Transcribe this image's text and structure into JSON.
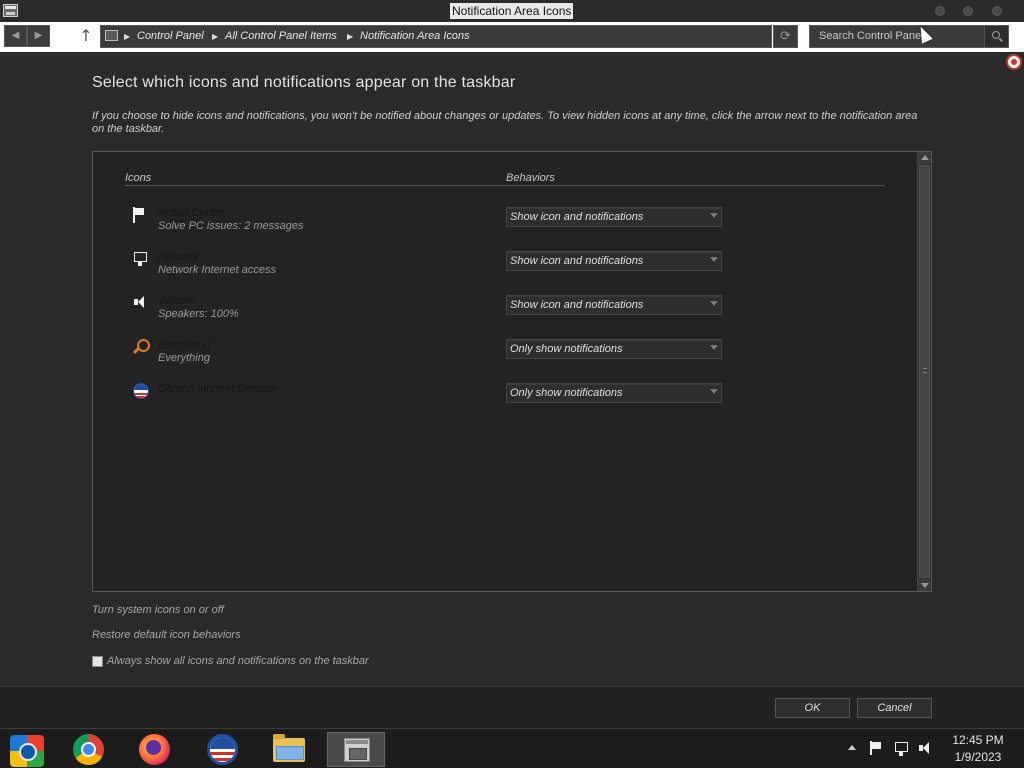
{
  "window": {
    "title": "Notification Area Icons"
  },
  "toolbar": {
    "breadcrumb": [
      "Control Panel",
      "All Control Panel Items",
      "Notification Area Icons"
    ],
    "search_placeholder": "Search Control Panel"
  },
  "page": {
    "title": "Select which icons and notifications appear on the taskbar",
    "description": "If you choose to hide icons and notifications, you won't be notified about changes or updates. To view hidden icons at any time, click the arrow next to the notification area on the taskbar."
  },
  "table": {
    "icons_header": "Icons",
    "behaviors_header": "Behaviors",
    "rows": [
      {
        "icon": "flag-icon",
        "name": "Action Center",
        "description": "Solve PC issues: 2 messages",
        "behavior": "Show icon and notifications"
      },
      {
        "icon": "network-monitor-icon",
        "name": "Network",
        "description": "Network Internet access",
        "behavior": "Show icon and notifications"
      },
      {
        "icon": "speaker-icon",
        "name": "Volume",
        "description": "Speakers: 100%",
        "behavior": "Show icon and notifications"
      },
      {
        "icon": "magnifier-icon",
        "name": "Everything",
        "description": "Everything",
        "behavior": "Only show notifications"
      },
      {
        "icon": "obama-logo-icon",
        "name": "Obama Internet Browser",
        "description": "",
        "behavior": "Only show notifications"
      }
    ]
  },
  "links": {
    "system_icons": "Turn system icons on or off",
    "restore_defaults": "Restore default icon behaviors"
  },
  "checkbox": {
    "label": "Always show all icons and notifications on the taskbar",
    "checked": false
  },
  "buttons": {
    "ok": "OK",
    "cancel": "Cancel"
  },
  "taskbar": {
    "apps": [
      "start-orb-icon",
      "chrome-icon",
      "firefox-icon",
      "obama-browser-icon",
      "file-explorer-icon",
      "control-panel-icon"
    ],
    "time": "12:45 PM",
    "date": "1/9/2023"
  }
}
